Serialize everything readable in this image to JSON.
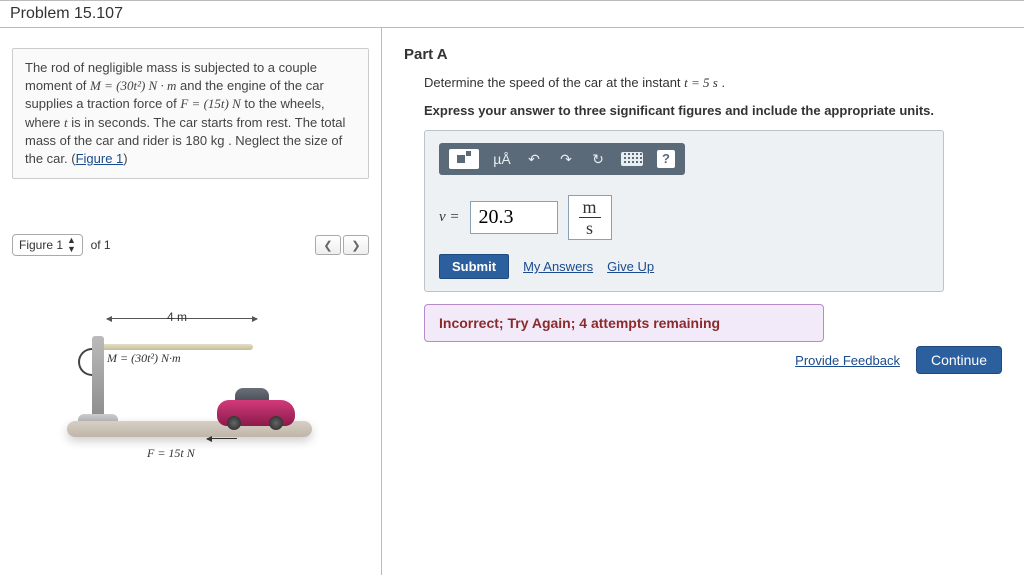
{
  "problem_title": "Problem 15.107",
  "statement": {
    "t1": "The rod of negligible mass is subjected to a couple moment of ",
    "m_expr": "M = (30t²) N · m",
    "t2": " and the engine of the car supplies a traction force of ",
    "f_expr": "F = (15t) N",
    "t3": " to the wheels, where ",
    "tvar": "t",
    "t4": " is in seconds. The car starts from rest. The total mass of the car and rider is 180 ",
    "mass_unit": "kg",
    "t5": " . Neglect the size of the car. (",
    "figure_link": "Figure 1",
    "t6": ")"
  },
  "figure_nav": {
    "selected": "Figure 1",
    "of_label": "of 1"
  },
  "figure_labels": {
    "dim": "4 m",
    "moment": "M = (30t²) N·m",
    "force": "F = 15t N"
  },
  "part": {
    "title": "Part A",
    "prompt_pre": "Determine the speed of the car at the instant ",
    "prompt_eq": "t = 5 s",
    "prompt_post": ".",
    "instruction": "Express your answer to three significant figures and include the appropriate units."
  },
  "toolbar": {
    "units_label": "µÅ",
    "help": "?"
  },
  "answer": {
    "var_label": "v =",
    "value": "20.3",
    "unit_num": "m",
    "unit_den": "s"
  },
  "actions": {
    "submit": "Submit",
    "my_answers": "My Answers",
    "give_up": "Give Up"
  },
  "feedback": "Incorrect; Try Again; 4 attempts remaining",
  "footer": {
    "provide_feedback": "Provide Feedback",
    "continue": "Continue"
  }
}
